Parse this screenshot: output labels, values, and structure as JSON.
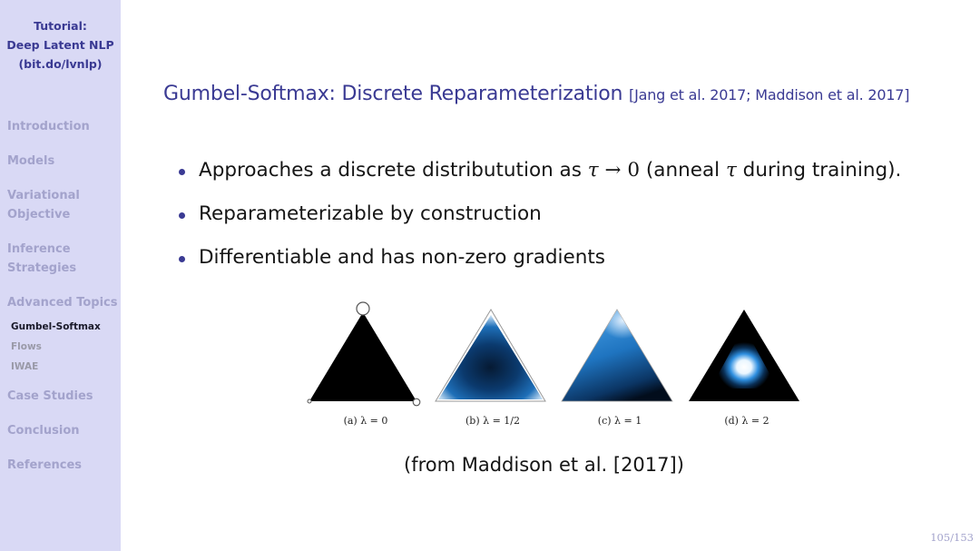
{
  "sidebar": {
    "title_lines": [
      "Tutorial:",
      "Deep Latent NLP",
      "(bit.do/lvnlp)"
    ],
    "sections": [
      {
        "label_lines": [
          "Introduction"
        ]
      },
      {
        "label_lines": [
          "Models"
        ]
      },
      {
        "label_lines": [
          "Variational",
          "Objective"
        ]
      },
      {
        "label_lines": [
          "Inference",
          "Strategies"
        ]
      },
      {
        "label_lines": [
          "Advanced Topics"
        ]
      },
      {
        "label_lines": [
          "Case Studies"
        ]
      },
      {
        "label_lines": [
          "Conclusion"
        ]
      },
      {
        "label_lines": [
          "References"
        ]
      }
    ],
    "subsections": [
      {
        "label": "Gumbel-Softmax",
        "active": true
      },
      {
        "label": "Flows",
        "active": false
      },
      {
        "label": "IWAE",
        "active": false
      }
    ]
  },
  "slide": {
    "title": "Gumbel-Softmax: Discrete Reparameterization",
    "citation": "[Jang et al. 2017; Maddison et al. 2017]",
    "bullets": [
      {
        "pre": "Approaches a discrete distributution as ",
        "math1": "τ",
        "arrow": " → 0",
        "mid": " (anneal ",
        "math2": "τ",
        "post": " during training)."
      },
      {
        "text": "Reparameterizable by construction"
      },
      {
        "text": "Differentiable and has non-zero gradients"
      }
    ],
    "figure": {
      "panels": [
        {
          "caption": "(a) λ = 0",
          "style": "black"
        },
        {
          "caption": "(b) λ = 1/2",
          "style": "blue-dark-center"
        },
        {
          "caption": "(c) λ = 1",
          "style": "blue-bright"
        },
        {
          "caption": "(d) λ = 2",
          "style": "black-bright-center"
        }
      ]
    },
    "source": "(from Maddison et al. [2017])",
    "page": "105/153"
  },
  "colors": {
    "accent": "#3a3a93",
    "sidebar_bg": "#d9d9f5",
    "sidebar_inactive": "#a3a3cc"
  }
}
